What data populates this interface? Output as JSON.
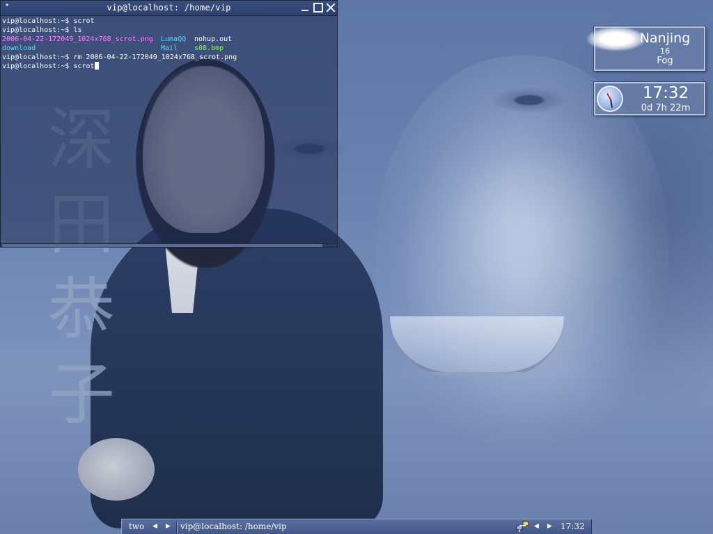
{
  "wallpaper": {
    "kanji": [
      "深",
      "田",
      "恭",
      "子"
    ]
  },
  "terminal": {
    "title": "vip@localhost: /home/vip",
    "menu_glyph": "•",
    "lines": [
      {
        "prompt": "vip@localhost:~$ ",
        "command": "scrot"
      },
      {
        "prompt": "vip@localhost:~$ ",
        "command": "ls"
      },
      {
        "prompt": "vip@localhost:~$ ",
        "command": "rm 2006-04-22-172049_1024x768_scrot.png"
      },
      {
        "prompt": "vip@localhost:~$ ",
        "command": "scrot"
      }
    ],
    "ls_row1": {
      "a": "2006-04-22-172049_1024x768_scrot.png",
      "b": "LumaQQ",
      "c": "nohup.out"
    },
    "ls_row2": {
      "a": "download",
      "b": "Mail",
      "c": "s08.bmp"
    },
    "colors": {
      "image_file": "#ff7fff",
      "directory": "#5ad7ff",
      "bmp_file": "#7dff5a"
    }
  },
  "weather": {
    "city": "Nanjing",
    "temperature": "16",
    "condition": "Fog",
    "icon": "fog-cloud-icon"
  },
  "clock_widget": {
    "time": "17:32",
    "uptime": "0d 7h 22m",
    "icon": "analog-clock-icon"
  },
  "panel": {
    "workspace": "two",
    "prev_glyph": "◀",
    "next_glyph": "▶",
    "task_title": "vip@localhost: /home/vip",
    "tray_icon": "network-status-icon",
    "clock": "17:32"
  }
}
